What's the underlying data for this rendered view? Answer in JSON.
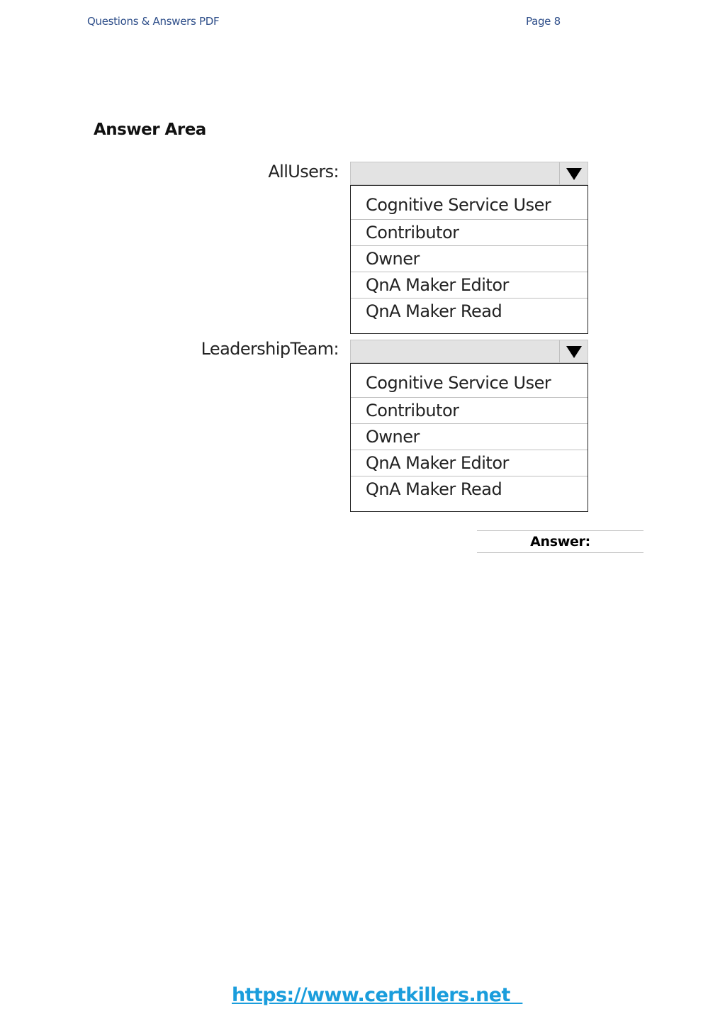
{
  "header": {
    "left": "Questions & Answers PDF",
    "right": "Page 8"
  },
  "answer_area": {
    "title": "Answer Area",
    "fields": [
      {
        "label": "AllUsers:",
        "selected": "",
        "icon": "dropdown-arrow-icon",
        "options": [
          "Cognitive Service User",
          "Contributor",
          "Owner",
          "QnA Maker Editor",
          "QnA Maker Read"
        ]
      },
      {
        "label": "LeadershipTeam:",
        "selected": "",
        "icon": "dropdown-arrow-icon",
        "options": [
          "Cognitive Service User",
          "Contributor",
          "Owner",
          "QnA Maker Editor",
          "QnA Maker Read"
        ]
      }
    ]
  },
  "answer_label": "Answer:",
  "footer": {
    "link_text": "https://www.certkillers.net  ",
    "link_color": "#1a9ddc"
  },
  "colors": {
    "header_text": "#2f4f8a",
    "dropdown_bg": "#e3e3e3"
  }
}
